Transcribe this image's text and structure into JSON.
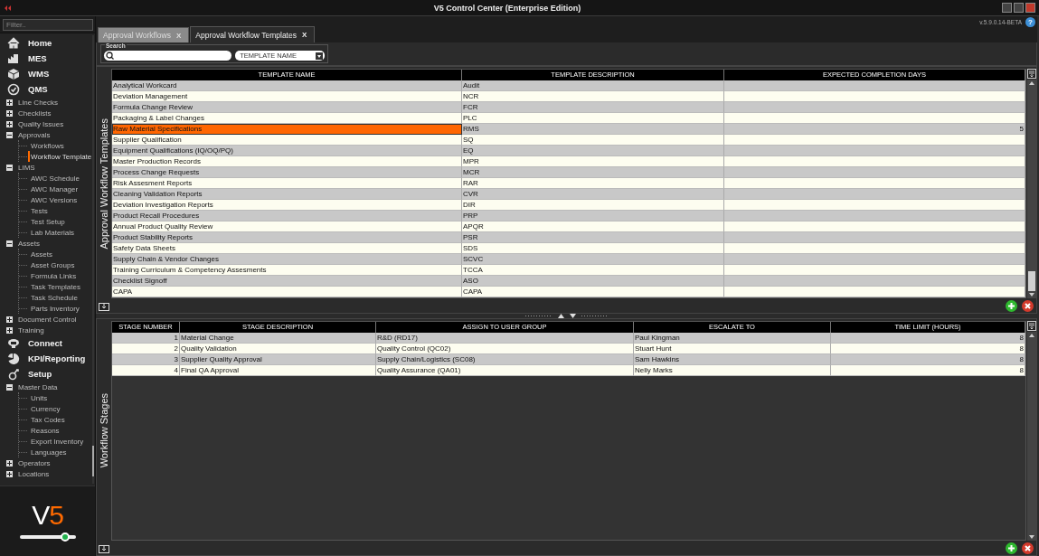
{
  "window": {
    "title": "V5 Control Center (Enterprise Edition)"
  },
  "version": "v.5.9.0.14-BETA",
  "help": "?",
  "tabs": [
    {
      "label": "Approval Workflows",
      "close": "X",
      "selected": false
    },
    {
      "label": "Approval Workflow Templates",
      "close": "X",
      "selected": true
    }
  ],
  "sidebar": {
    "filter_placeholder": "Filter..",
    "items": [
      {
        "kind": "module",
        "label": "Home"
      },
      {
        "kind": "module",
        "label": "MES"
      },
      {
        "kind": "module",
        "label": "WMS"
      },
      {
        "kind": "module",
        "label": "QMS"
      },
      {
        "kind": "group",
        "label": "Line Checks",
        "expanded": false
      },
      {
        "kind": "group",
        "label": "Checklists",
        "expanded": false
      },
      {
        "kind": "group",
        "label": "Quality Issues",
        "expanded": false
      },
      {
        "kind": "group",
        "label": "Approvals",
        "expanded": true,
        "children": [
          {
            "label": "Workflows",
            "selected": false
          },
          {
            "label": "Workflow Template",
            "selected": true
          }
        ]
      },
      {
        "kind": "group",
        "label": "LIMS",
        "expanded": true,
        "children": [
          {
            "label": "AWC Schedule",
            "selected": false
          },
          {
            "label": "AWC Manager",
            "selected": false
          },
          {
            "label": "AWC Versions",
            "selected": false
          },
          {
            "label": "Tests",
            "selected": false
          },
          {
            "label": "Test Setup",
            "selected": false
          },
          {
            "label": "Lab Materials",
            "selected": false
          }
        ]
      },
      {
        "kind": "group",
        "label": "Assets",
        "expanded": true,
        "children": [
          {
            "label": "Assets",
            "selected": false
          },
          {
            "label": "Asset Groups",
            "selected": false
          },
          {
            "label": "Formula Links",
            "selected": false
          },
          {
            "label": "Task Templates",
            "selected": false
          },
          {
            "label": "Task Schedule",
            "selected": false
          },
          {
            "label": "Parts Inventory",
            "selected": false
          }
        ]
      },
      {
        "kind": "group",
        "label": "Document Control",
        "expanded": false
      },
      {
        "kind": "group",
        "label": "Training",
        "expanded": false
      },
      {
        "kind": "module",
        "label": "Connect"
      },
      {
        "kind": "module",
        "label": "KPI/Reporting"
      },
      {
        "kind": "module",
        "label": "Setup"
      },
      {
        "kind": "group",
        "label": "Master Data",
        "expanded": true,
        "children": [
          {
            "label": "Units",
            "selected": false
          },
          {
            "label": "Currency",
            "selected": false
          },
          {
            "label": "Tax Codes",
            "selected": false
          },
          {
            "label": "Reasons",
            "selected": false
          },
          {
            "label": "Export Inventory",
            "selected": false
          },
          {
            "label": "Languages",
            "selected": false
          }
        ]
      },
      {
        "kind": "group",
        "label": "Operators",
        "expanded": false
      },
      {
        "kind": "group",
        "label": "Locations",
        "expanded": false
      }
    ]
  },
  "logo": {
    "text": "V5",
    "slider": {
      "level": 0.82
    }
  },
  "search": {
    "label": "Search",
    "filter_by": "TEMPLATE NAME"
  },
  "templates": {
    "title": "Approval Workflow Templates",
    "columns": [
      "TEMPLATE NAME",
      "TEMPLATE DESCRIPTION",
      "EXPECTED COMPLETION DAYS"
    ],
    "rows": [
      {
        "template_name": "Analytical Workcard",
        "template_description": "Audit",
        "selected": false
      },
      {
        "template_name": "Deviation Management",
        "template_description": "NCR",
        "selected": false
      },
      {
        "template_name": "Formula Change Review",
        "template_description": "FCR",
        "selected": false
      },
      {
        "template_name": "Packaging & Label Changes",
        "template_description": "PLC",
        "selected": false
      },
      {
        "template_name": "Raw Material Specifications",
        "template_description": "RMS",
        "expected_completion_days": "5",
        "selected": true
      },
      {
        "template_name": "Supplier Qualification",
        "template_description": "SQ",
        "selected": false
      },
      {
        "template_name": "Equipment Qualifications (IQ/OQ/PQ)",
        "template_description": "EQ",
        "selected": false
      },
      {
        "template_name": "Master Production Records",
        "template_description": "MPR",
        "selected": false
      },
      {
        "template_name": "Process Change Requests",
        "template_description": "MCR",
        "selected": false
      },
      {
        "template_name": "Risk Assesment Reports",
        "template_description": "RAR",
        "selected": false
      },
      {
        "template_name": "Cleaning Validation Reports",
        "template_description": "CVR",
        "selected": false
      },
      {
        "template_name": "Deviation Investigation Reports",
        "template_description": "DIR",
        "selected": false
      },
      {
        "template_name": "Product Recall Procedures",
        "template_description": "PRP",
        "selected": false
      },
      {
        "template_name": "Annual Product Quality Review",
        "template_description": "APQR",
        "selected": false
      },
      {
        "template_name": "Product Stability Reports",
        "template_description": "PSR",
        "selected": false
      },
      {
        "template_name": "Safety Data Sheets",
        "template_description": "SDS",
        "selected": false
      },
      {
        "template_name": "Supply Chain & Vendor Changes",
        "template_description": "SCVC",
        "selected": false
      },
      {
        "template_name": "Training Curriculum & Competency Assesments",
        "template_description": "TCCA",
        "selected": false
      },
      {
        "template_name": "Checklist Signoff",
        "template_description": "ASO",
        "selected": false
      },
      {
        "template_name": "CAPA",
        "template_description": "CAPA",
        "selected": false
      }
    ]
  },
  "stages": {
    "title": "Workflow Stages",
    "columns": [
      "STAGE NUMBER",
      "STAGE DESCRIPTION",
      "ASSIGN TO USER GROUP",
      "ESCALATE TO",
      "TIME LIMIT (HOURS)"
    ],
    "rows": [
      {
        "stage_number": "1",
        "stage_description": "Material Change",
        "assign_to_user_group": "R&D (RD17)",
        "escalate_to": "Paul Kingman",
        "time_limit": "8"
      },
      {
        "stage_number": "2",
        "stage_description": "Quality Validation",
        "assign_to_user_group": "Quality Control (QC02)",
        "escalate_to": "Stuart Hunt",
        "time_limit": "8"
      },
      {
        "stage_number": "3",
        "stage_description": "Supplier Quality Approval",
        "assign_to_user_group": "Supply Chain/Logistics (SC08)",
        "escalate_to": "Sam Hawkins",
        "time_limit": "8"
      },
      {
        "stage_number": "4",
        "stage_description": "Final QA Approval",
        "assign_to_user_group": "Quality Assurance (QA01)",
        "escalate_to": "Nelly Marks",
        "time_limit": "8"
      }
    ]
  }
}
